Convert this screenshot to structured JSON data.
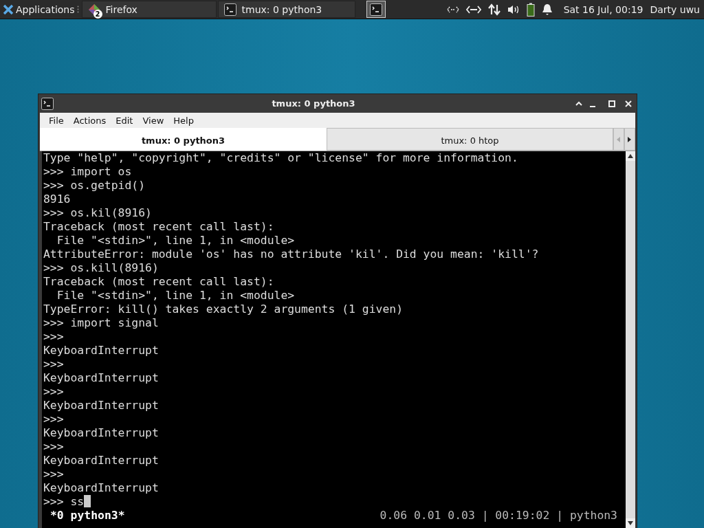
{
  "panel": {
    "apps_menu": "Applications",
    "tasks": [
      {
        "label": "Firefox",
        "badge": "2",
        "kind": "browser",
        "selected": false
      },
      {
        "label": "tmux: 0 python3",
        "kind": "terminal",
        "selected": false
      },
      {
        "kind": "terminal-icon-only",
        "selected": true
      }
    ],
    "clock": "Sat 16 Jul, 00:19",
    "user": "Darty uwu"
  },
  "window": {
    "title": "tmux: 0 python3",
    "menu": [
      "File",
      "Actions",
      "Edit",
      "View",
      "Help"
    ],
    "tabs": [
      {
        "label": "tmux: 0 python3",
        "selected": true
      },
      {
        "label": "tmux: 0 htop",
        "selected": false
      }
    ],
    "terminal": {
      "lines": [
        "Type \"help\", \"copyright\", \"credits\" or \"license\" for more information.",
        ">>> import os",
        ">>> os.getpid()",
        "8916",
        ">>> os.kil(8916)",
        "Traceback (most recent call last):",
        "  File \"<stdin>\", line 1, in <module>",
        "AttributeError: module 'os' has no attribute 'kil'. Did you mean: 'kill'?",
        ">>> os.kill(8916)",
        "Traceback (most recent call last):",
        "  File \"<stdin>\", line 1, in <module>",
        "TypeError: kill() takes exactly 2 arguments (1 given)",
        ">>> import signal",
        ">>>",
        "KeyboardInterrupt",
        ">>>",
        "KeyboardInterrupt",
        ">>>",
        "KeyboardInterrupt",
        ">>>",
        "KeyboardInterrupt",
        ">>>",
        "KeyboardInterrupt",
        ">>>",
        "KeyboardInterrupt",
        ">>> ss"
      ],
      "cursor": true,
      "status_left": "*0 python3*",
      "status_right": "0.06 0.01 0.03 | 00:19:02 | python3"
    }
  }
}
